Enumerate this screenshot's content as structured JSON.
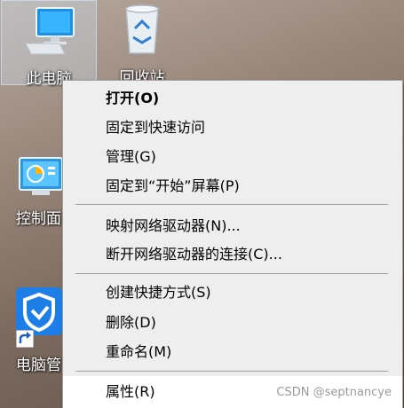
{
  "desktop": {
    "icons": [
      {
        "label": "此电脑",
        "icon": "computer-icon"
      },
      {
        "label": "回收站",
        "icon": "recycle-bin-icon"
      },
      {
        "label": "控制面",
        "icon": "control-panel-icon"
      },
      {
        "label": "电脑管",
        "icon": "shield-icon"
      }
    ]
  },
  "context_menu": {
    "items": [
      {
        "label": "打开(O)",
        "bold": true
      },
      {
        "label": "固定到快速访问"
      },
      {
        "label": "管理(G)"
      },
      {
        "label": "固定到“开始”屏幕(P)"
      },
      {
        "label": "映射网络驱动器(N)..."
      },
      {
        "label": "断开网络驱动器的连接(C)..."
      },
      {
        "label": "创建快捷方式(S)"
      },
      {
        "label": "删除(D)"
      },
      {
        "label": "重命名(M)"
      },
      {
        "label": "属性(R)",
        "highlighted": true
      }
    ]
  },
  "watermark": "CSDN @septnancye",
  "colors": {
    "menu_bg": "#eeeeee",
    "hover_bg": "#ffffff",
    "separator": "#a0a0a0"
  }
}
